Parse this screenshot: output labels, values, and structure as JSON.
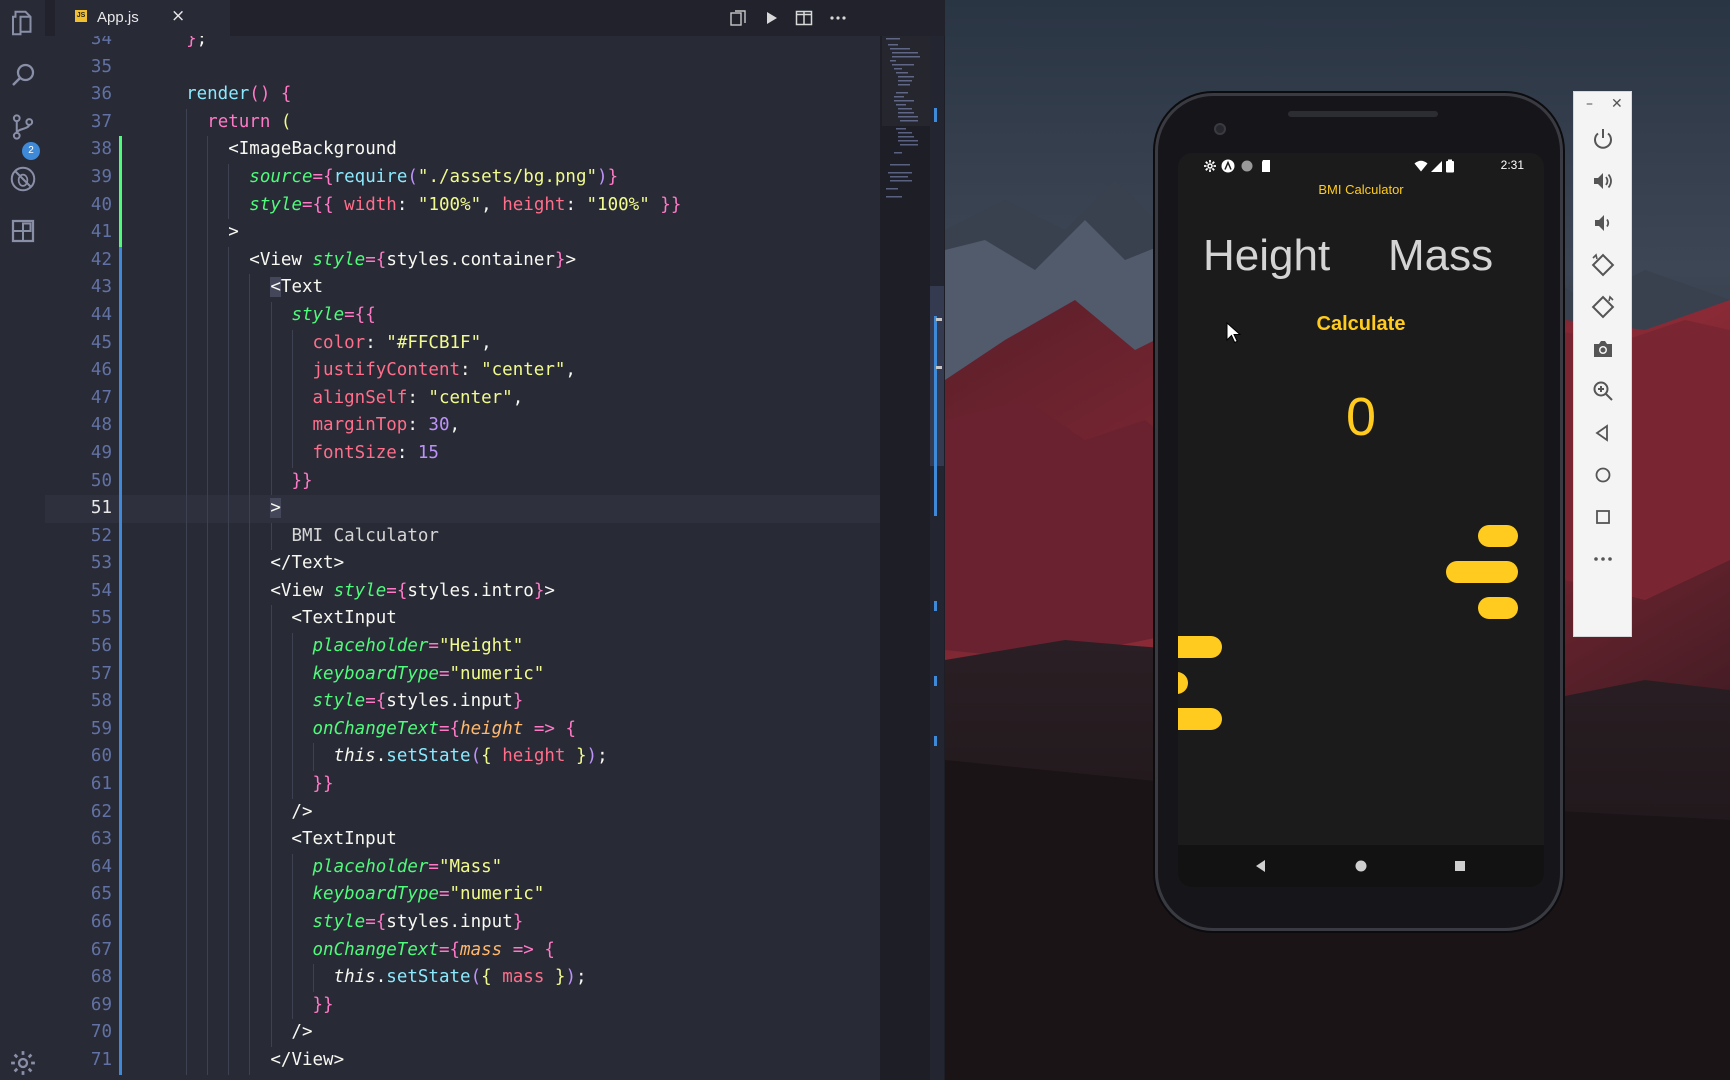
{
  "editor": {
    "tab": {
      "file_icon": "JS",
      "filename": "App.js",
      "close": "×"
    },
    "activity_badge": "2",
    "current_line": 51,
    "lines": [
      {
        "n": 34,
        "tokens": [
          [
            "t-plain",
            "  "
          ],
          [
            "t-brace",
            "}"
          ],
          [
            "t-plain",
            ";"
          ]
        ]
      },
      {
        "n": 35,
        "tokens": []
      },
      {
        "n": 36,
        "tokens": [
          [
            "t-plain",
            "  "
          ],
          [
            "t-fn",
            "render"
          ],
          [
            "t-brace",
            "()"
          ],
          [
            "t-plain",
            " "
          ],
          [
            "t-brace",
            "{"
          ]
        ]
      },
      {
        "n": 37,
        "tokens": [
          [
            "t-plain",
            "    "
          ],
          [
            "t-kw",
            "return"
          ],
          [
            "t-plain",
            " "
          ],
          [
            "t-brace2",
            "("
          ]
        ]
      },
      {
        "n": 38,
        "tokens": [
          [
            "t-plain",
            "      <"
          ],
          [
            "t-comp",
            "ImageBackground"
          ]
        ]
      },
      {
        "n": 39,
        "tokens": [
          [
            "t-plain",
            "        "
          ],
          [
            "t-attr",
            "source"
          ],
          [
            "t-key",
            "="
          ],
          [
            "t-brace",
            "{"
          ],
          [
            "t-fn",
            "require"
          ],
          [
            "t-brace3",
            "("
          ],
          [
            "t-str",
            "\"./assets/bg.png\""
          ],
          [
            "t-brace3",
            ")"
          ],
          [
            "t-brace",
            "}"
          ]
        ]
      },
      {
        "n": 40,
        "tokens": [
          [
            "t-plain",
            "        "
          ],
          [
            "t-attr",
            "style"
          ],
          [
            "t-key",
            "="
          ],
          [
            "t-brace",
            "{{"
          ],
          [
            "t-plain",
            " "
          ],
          [
            "t-prop",
            "width"
          ],
          [
            "t-plain",
            ": "
          ],
          [
            "t-str",
            "\"100%\""
          ],
          [
            "t-plain",
            ", "
          ],
          [
            "t-prop",
            "height"
          ],
          [
            "t-plain",
            ": "
          ],
          [
            "t-str",
            "\"100%\""
          ],
          [
            "t-plain",
            " "
          ],
          [
            "t-brace",
            "}}"
          ]
        ]
      },
      {
        "n": 41,
        "tokens": [
          [
            "t-plain",
            "      >"
          ]
        ]
      },
      {
        "n": 42,
        "tokens": [
          [
            "t-plain",
            "        <"
          ],
          [
            "t-comp",
            "View"
          ],
          [
            "t-plain",
            " "
          ],
          [
            "t-attr",
            "style"
          ],
          [
            "t-key",
            "="
          ],
          [
            "t-brace",
            "{"
          ],
          [
            "t-plain",
            "styles.container"
          ],
          [
            "t-brace",
            "}"
          ],
          [
            "t-plain",
            ">"
          ]
        ]
      },
      {
        "n": 43,
        "tokens": [
          [
            "t-plain",
            "          "
          ],
          [
            "t-cursor",
            "<"
          ],
          [
            "t-comp",
            "Text"
          ]
        ]
      },
      {
        "n": 44,
        "tokens": [
          [
            "t-plain",
            "            "
          ],
          [
            "t-attr",
            "style"
          ],
          [
            "t-key",
            "="
          ],
          [
            "t-brace",
            "{{"
          ]
        ]
      },
      {
        "n": 45,
        "tokens": [
          [
            "t-plain",
            "              "
          ],
          [
            "t-prop",
            "color"
          ],
          [
            "t-plain",
            ": "
          ],
          [
            "t-str",
            "\"#FFCB1F\""
          ],
          [
            "t-plain",
            ","
          ]
        ]
      },
      {
        "n": 46,
        "tokens": [
          [
            "t-plain",
            "              "
          ],
          [
            "t-prop",
            "justifyContent"
          ],
          [
            "t-plain",
            ": "
          ],
          [
            "t-str",
            "\"center\""
          ],
          [
            "t-plain",
            ","
          ]
        ]
      },
      {
        "n": 47,
        "tokens": [
          [
            "t-plain",
            "              "
          ],
          [
            "t-prop",
            "alignSelf"
          ],
          [
            "t-plain",
            ": "
          ],
          [
            "t-str",
            "\"center\""
          ],
          [
            "t-plain",
            ","
          ]
        ]
      },
      {
        "n": 48,
        "tokens": [
          [
            "t-plain",
            "              "
          ],
          [
            "t-prop",
            "marginTop"
          ],
          [
            "t-plain",
            ": "
          ],
          [
            "t-num",
            "30"
          ],
          [
            "t-plain",
            ","
          ]
        ]
      },
      {
        "n": 49,
        "tokens": [
          [
            "t-plain",
            "              "
          ],
          [
            "t-prop",
            "fontSize"
          ],
          [
            "t-plain",
            ": "
          ],
          [
            "t-num",
            "15"
          ]
        ]
      },
      {
        "n": 50,
        "tokens": [
          [
            "t-plain",
            "            "
          ],
          [
            "t-brace",
            "}}"
          ]
        ]
      },
      {
        "n": 51,
        "tokens": [
          [
            "t-plain",
            "          "
          ],
          [
            "t-cursor",
            ">"
          ]
        ]
      },
      {
        "n": 52,
        "tokens": [
          [
            "t-plain",
            "            "
          ],
          [
            "t-text",
            "BMI Calculator"
          ]
        ]
      },
      {
        "n": 53,
        "tokens": [
          [
            "t-plain",
            "          </"
          ],
          [
            "t-comp",
            "Text"
          ],
          [
            "t-plain",
            ">"
          ]
        ]
      },
      {
        "n": 54,
        "tokens": [
          [
            "t-plain",
            "          <"
          ],
          [
            "t-comp",
            "View"
          ],
          [
            "t-plain",
            " "
          ],
          [
            "t-attr",
            "style"
          ],
          [
            "t-key",
            "="
          ],
          [
            "t-brace",
            "{"
          ],
          [
            "t-plain",
            "styles.intro"
          ],
          [
            "t-brace",
            "}"
          ],
          [
            "t-plain",
            ">"
          ]
        ]
      },
      {
        "n": 55,
        "tokens": [
          [
            "t-plain",
            "            <"
          ],
          [
            "t-comp",
            "TextInput"
          ]
        ]
      },
      {
        "n": 56,
        "tokens": [
          [
            "t-plain",
            "              "
          ],
          [
            "t-attr",
            "placeholder"
          ],
          [
            "t-key",
            "="
          ],
          [
            "t-str",
            "\"Height\""
          ]
        ]
      },
      {
        "n": 57,
        "tokens": [
          [
            "t-plain",
            "              "
          ],
          [
            "t-attr",
            "keyboardType"
          ],
          [
            "t-key",
            "="
          ],
          [
            "t-str",
            "\"numeric\""
          ]
        ]
      },
      {
        "n": 58,
        "tokens": [
          [
            "t-plain",
            "              "
          ],
          [
            "t-attr",
            "style"
          ],
          [
            "t-key",
            "="
          ],
          [
            "t-brace",
            "{"
          ],
          [
            "t-plain",
            "styles.input"
          ],
          [
            "t-brace",
            "}"
          ]
        ]
      },
      {
        "n": 59,
        "tokens": [
          [
            "t-plain",
            "              "
          ],
          [
            "t-attr",
            "onChangeText"
          ],
          [
            "t-key",
            "="
          ],
          [
            "t-brace",
            "{"
          ],
          [
            "t-param",
            "height"
          ],
          [
            "t-plain",
            " "
          ],
          [
            "t-kw",
            "=>"
          ],
          [
            "t-plain",
            " "
          ],
          [
            "t-brace",
            "{"
          ]
        ]
      },
      {
        "n": 60,
        "tokens": [
          [
            "t-plain",
            "                "
          ],
          [
            "t-this",
            "this"
          ],
          [
            "t-plain",
            "."
          ],
          [
            "t-fn",
            "setState"
          ],
          [
            "t-brace3",
            "("
          ],
          [
            "t-brace2",
            "{"
          ],
          [
            "t-plain",
            " "
          ],
          [
            "t-prop",
            "height"
          ],
          [
            "t-plain",
            " "
          ],
          [
            "t-brace2",
            "}"
          ],
          [
            "t-brace3",
            ")"
          ],
          [
            "t-plain",
            ";"
          ]
        ]
      },
      {
        "n": 61,
        "tokens": [
          [
            "t-plain",
            "              "
          ],
          [
            "t-brace",
            "}}"
          ]
        ]
      },
      {
        "n": 62,
        "tokens": [
          [
            "t-plain",
            "            />"
          ]
        ]
      },
      {
        "n": 63,
        "tokens": [
          [
            "t-plain",
            "            <"
          ],
          [
            "t-comp",
            "TextInput"
          ]
        ]
      },
      {
        "n": 64,
        "tokens": [
          [
            "t-plain",
            "              "
          ],
          [
            "t-attr",
            "placeholder"
          ],
          [
            "t-key",
            "="
          ],
          [
            "t-str",
            "\"Mass\""
          ]
        ]
      },
      {
        "n": 65,
        "tokens": [
          [
            "t-plain",
            "              "
          ],
          [
            "t-attr",
            "keyboardType"
          ],
          [
            "t-key",
            "="
          ],
          [
            "t-str",
            "\"numeric\""
          ]
        ]
      },
      {
        "n": 66,
        "tokens": [
          [
            "t-plain",
            "              "
          ],
          [
            "t-attr",
            "style"
          ],
          [
            "t-key",
            "="
          ],
          [
            "t-brace",
            "{"
          ],
          [
            "t-plain",
            "styles.input"
          ],
          [
            "t-brace",
            "}"
          ]
        ]
      },
      {
        "n": 67,
        "tokens": [
          [
            "t-plain",
            "              "
          ],
          [
            "t-attr",
            "onChangeText"
          ],
          [
            "t-key",
            "="
          ],
          [
            "t-brace",
            "{"
          ],
          [
            "t-param",
            "mass"
          ],
          [
            "t-plain",
            " "
          ],
          [
            "t-kw",
            "=>"
          ],
          [
            "t-plain",
            " "
          ],
          [
            "t-brace",
            "{"
          ]
        ]
      },
      {
        "n": 68,
        "tokens": [
          [
            "t-plain",
            "                "
          ],
          [
            "t-this",
            "this"
          ],
          [
            "t-plain",
            "."
          ],
          [
            "t-fn",
            "setState"
          ],
          [
            "t-brace3",
            "("
          ],
          [
            "t-brace2",
            "{"
          ],
          [
            "t-plain",
            " "
          ],
          [
            "t-prop",
            "mass"
          ],
          [
            "t-plain",
            " "
          ],
          [
            "t-brace2",
            "}"
          ],
          [
            "t-brace3",
            ")"
          ],
          [
            "t-plain",
            ";"
          ]
        ]
      },
      {
        "n": 69,
        "tokens": [
          [
            "t-plain",
            "              "
          ],
          [
            "t-brace",
            "}}"
          ]
        ]
      },
      {
        "n": 70,
        "tokens": [
          [
            "t-plain",
            "            />"
          ]
        ]
      },
      {
        "n": 71,
        "tokens": [
          [
            "t-plain",
            "          </"
          ],
          [
            "t-comp",
            "View"
          ],
          [
            "t-plain",
            ">"
          ]
        ]
      }
    ]
  },
  "phone": {
    "status_time": "2:31",
    "app_title": "BMI Calculator",
    "height_placeholder": "Height",
    "mass_placeholder": "Mass",
    "calculate_label": "Calculate",
    "result": "0"
  },
  "colors": {
    "accent": "#FFCB1F",
    "editor_bg": "#282a36"
  }
}
